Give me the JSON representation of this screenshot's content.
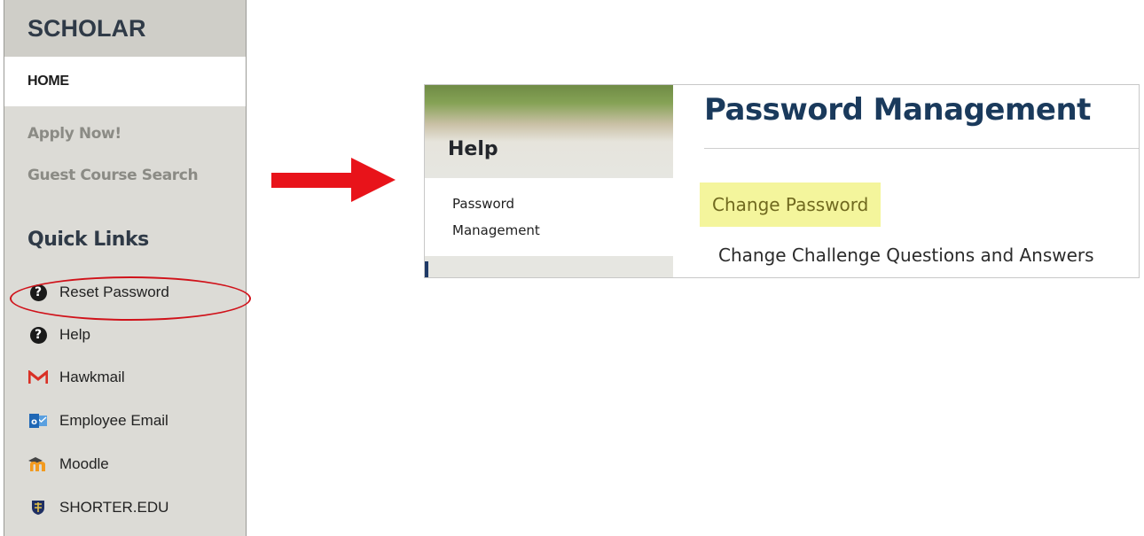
{
  "sidebar": {
    "title": "SCHOLAR",
    "home": "HOME",
    "links": [
      "Apply Now!",
      "Guest Course Search"
    ],
    "quick_links_heading": "Quick Links",
    "quick_links": [
      {
        "label": "Reset Password",
        "icon": "question-circle-icon"
      },
      {
        "label": "Help",
        "icon": "question-circle-icon"
      },
      {
        "label": "Hawkmail",
        "icon": "gmail-icon"
      },
      {
        "label": "Employee Email",
        "icon": "outlook-icon"
      },
      {
        "label": "Moodle",
        "icon": "moodle-icon"
      },
      {
        "label": "SHORTER.EDU",
        "icon": "shield-icon"
      }
    ]
  },
  "annotation": {
    "highlight_color": "#d0121a",
    "arrow_color": "#e8131a"
  },
  "help_panel": {
    "section_title": "Help",
    "nav_link_line1": "Password",
    "nav_link_line2": "Management",
    "page_title": "Password Management",
    "change_password": "Change Password",
    "change_challenge": "Change Challenge Questions and Answers",
    "highlight_color": "#f4f59c",
    "title_color": "#1a3a5c"
  }
}
